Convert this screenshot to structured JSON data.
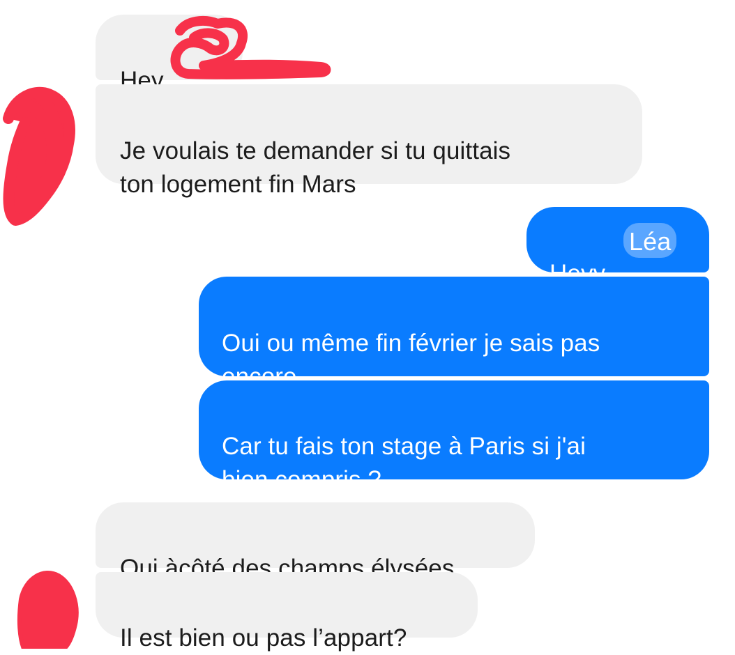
{
  "conversation": {
    "messages": [
      {
        "direction": "received",
        "text": "Hey"
      },
      {
        "direction": "received",
        "text": "Je voulais te demander si tu quittais\nton logement fin Mars"
      },
      {
        "direction": "sent",
        "text": "Heyy"
      },
      {
        "direction": "sent",
        "text": "Léa"
      },
      {
        "direction": "sent",
        "text": "Oui ou même fin février je sais pas\nencore"
      },
      {
        "direction": "sent",
        "text": "Car tu fais ton stage à Paris si j'ai\nbien compris ?"
      },
      {
        "direction": "received",
        "text": "Oui àcôté des champs élysées"
      },
      {
        "direction": "received",
        "text": "Il est bien ou pas l’appart?"
      }
    ]
  },
  "colors": {
    "received_bubble": "#f0f0f0",
    "sent_bubble": "#0a7cff",
    "redaction_scribble": "#f7314a"
  }
}
